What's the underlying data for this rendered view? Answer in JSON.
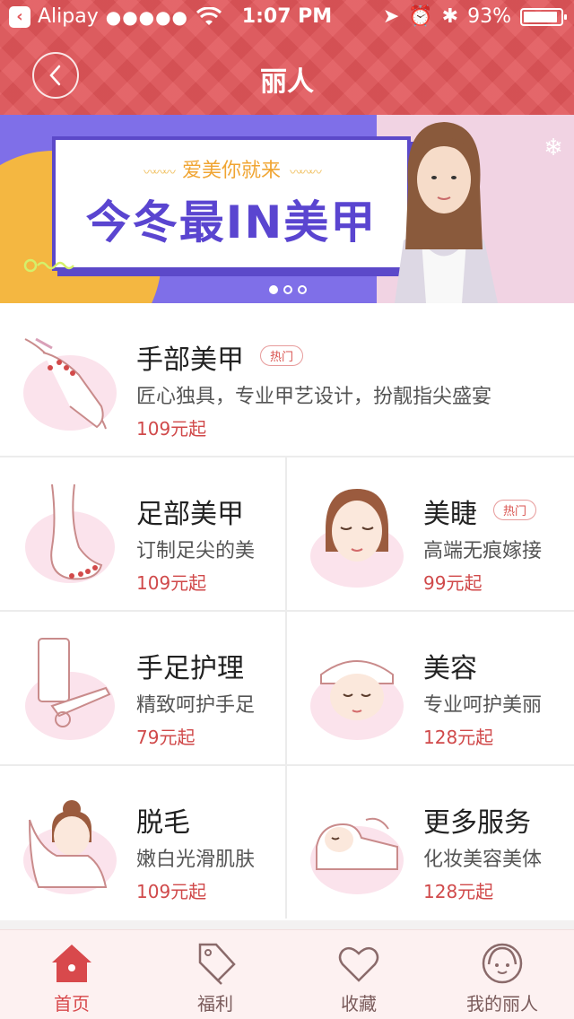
{
  "status_bar": {
    "carrier": "Alipay",
    "signal": "●●●●●",
    "time": "1:07 PM",
    "battery": "93%",
    "battery_level": 0.93
  },
  "nav": {
    "title": "丽人"
  },
  "banner": {
    "subtitle": "爱美你就来",
    "headline": "今冬最IN美甲",
    "slides": 3,
    "active_slide": 1
  },
  "services": [
    {
      "title": "手部美甲",
      "badge": "热门",
      "desc": "匠心独具，专业甲艺设计，扮靓指尖盛宴",
      "price": "109元起",
      "icon": "hands-nail-illustration"
    },
    {
      "title": "足部美甲",
      "badge": "",
      "desc": "订制足尖的美",
      "price": "109元起",
      "icon": "foot-nail-illustration"
    },
    {
      "title": "美睫",
      "badge": "热门",
      "desc": "高端无痕嫁接",
      "price": "99元起",
      "icon": "eyelash-illustration"
    },
    {
      "title": "手足护理",
      "badge": "",
      "desc": "精致呵护手足",
      "price": "79元起",
      "icon": "hand-foot-care-illustration"
    },
    {
      "title": "美容",
      "badge": "",
      "desc": "专业呵护美丽",
      "price": "128元起",
      "icon": "facial-illustration"
    },
    {
      "title": "脱毛",
      "badge": "",
      "desc": "嫩白光滑肌肤",
      "price": "109元起",
      "icon": "hair-removal-illustration"
    },
    {
      "title": "更多服务",
      "badge": "",
      "desc": "化妆美容美体",
      "price": "128元起",
      "icon": "more-services-illustration"
    }
  ],
  "tabs": [
    {
      "label": "首页",
      "icon": "home-icon",
      "active": true
    },
    {
      "label": "福利",
      "icon": "tag-icon",
      "active": false
    },
    {
      "label": "收藏",
      "icon": "heart-icon",
      "active": false
    },
    {
      "label": "我的丽人",
      "icon": "profile-icon",
      "active": false
    }
  ],
  "colors": {
    "header": "#e2565a",
    "price": "#d0494a",
    "active_tab": "#d8494c"
  }
}
